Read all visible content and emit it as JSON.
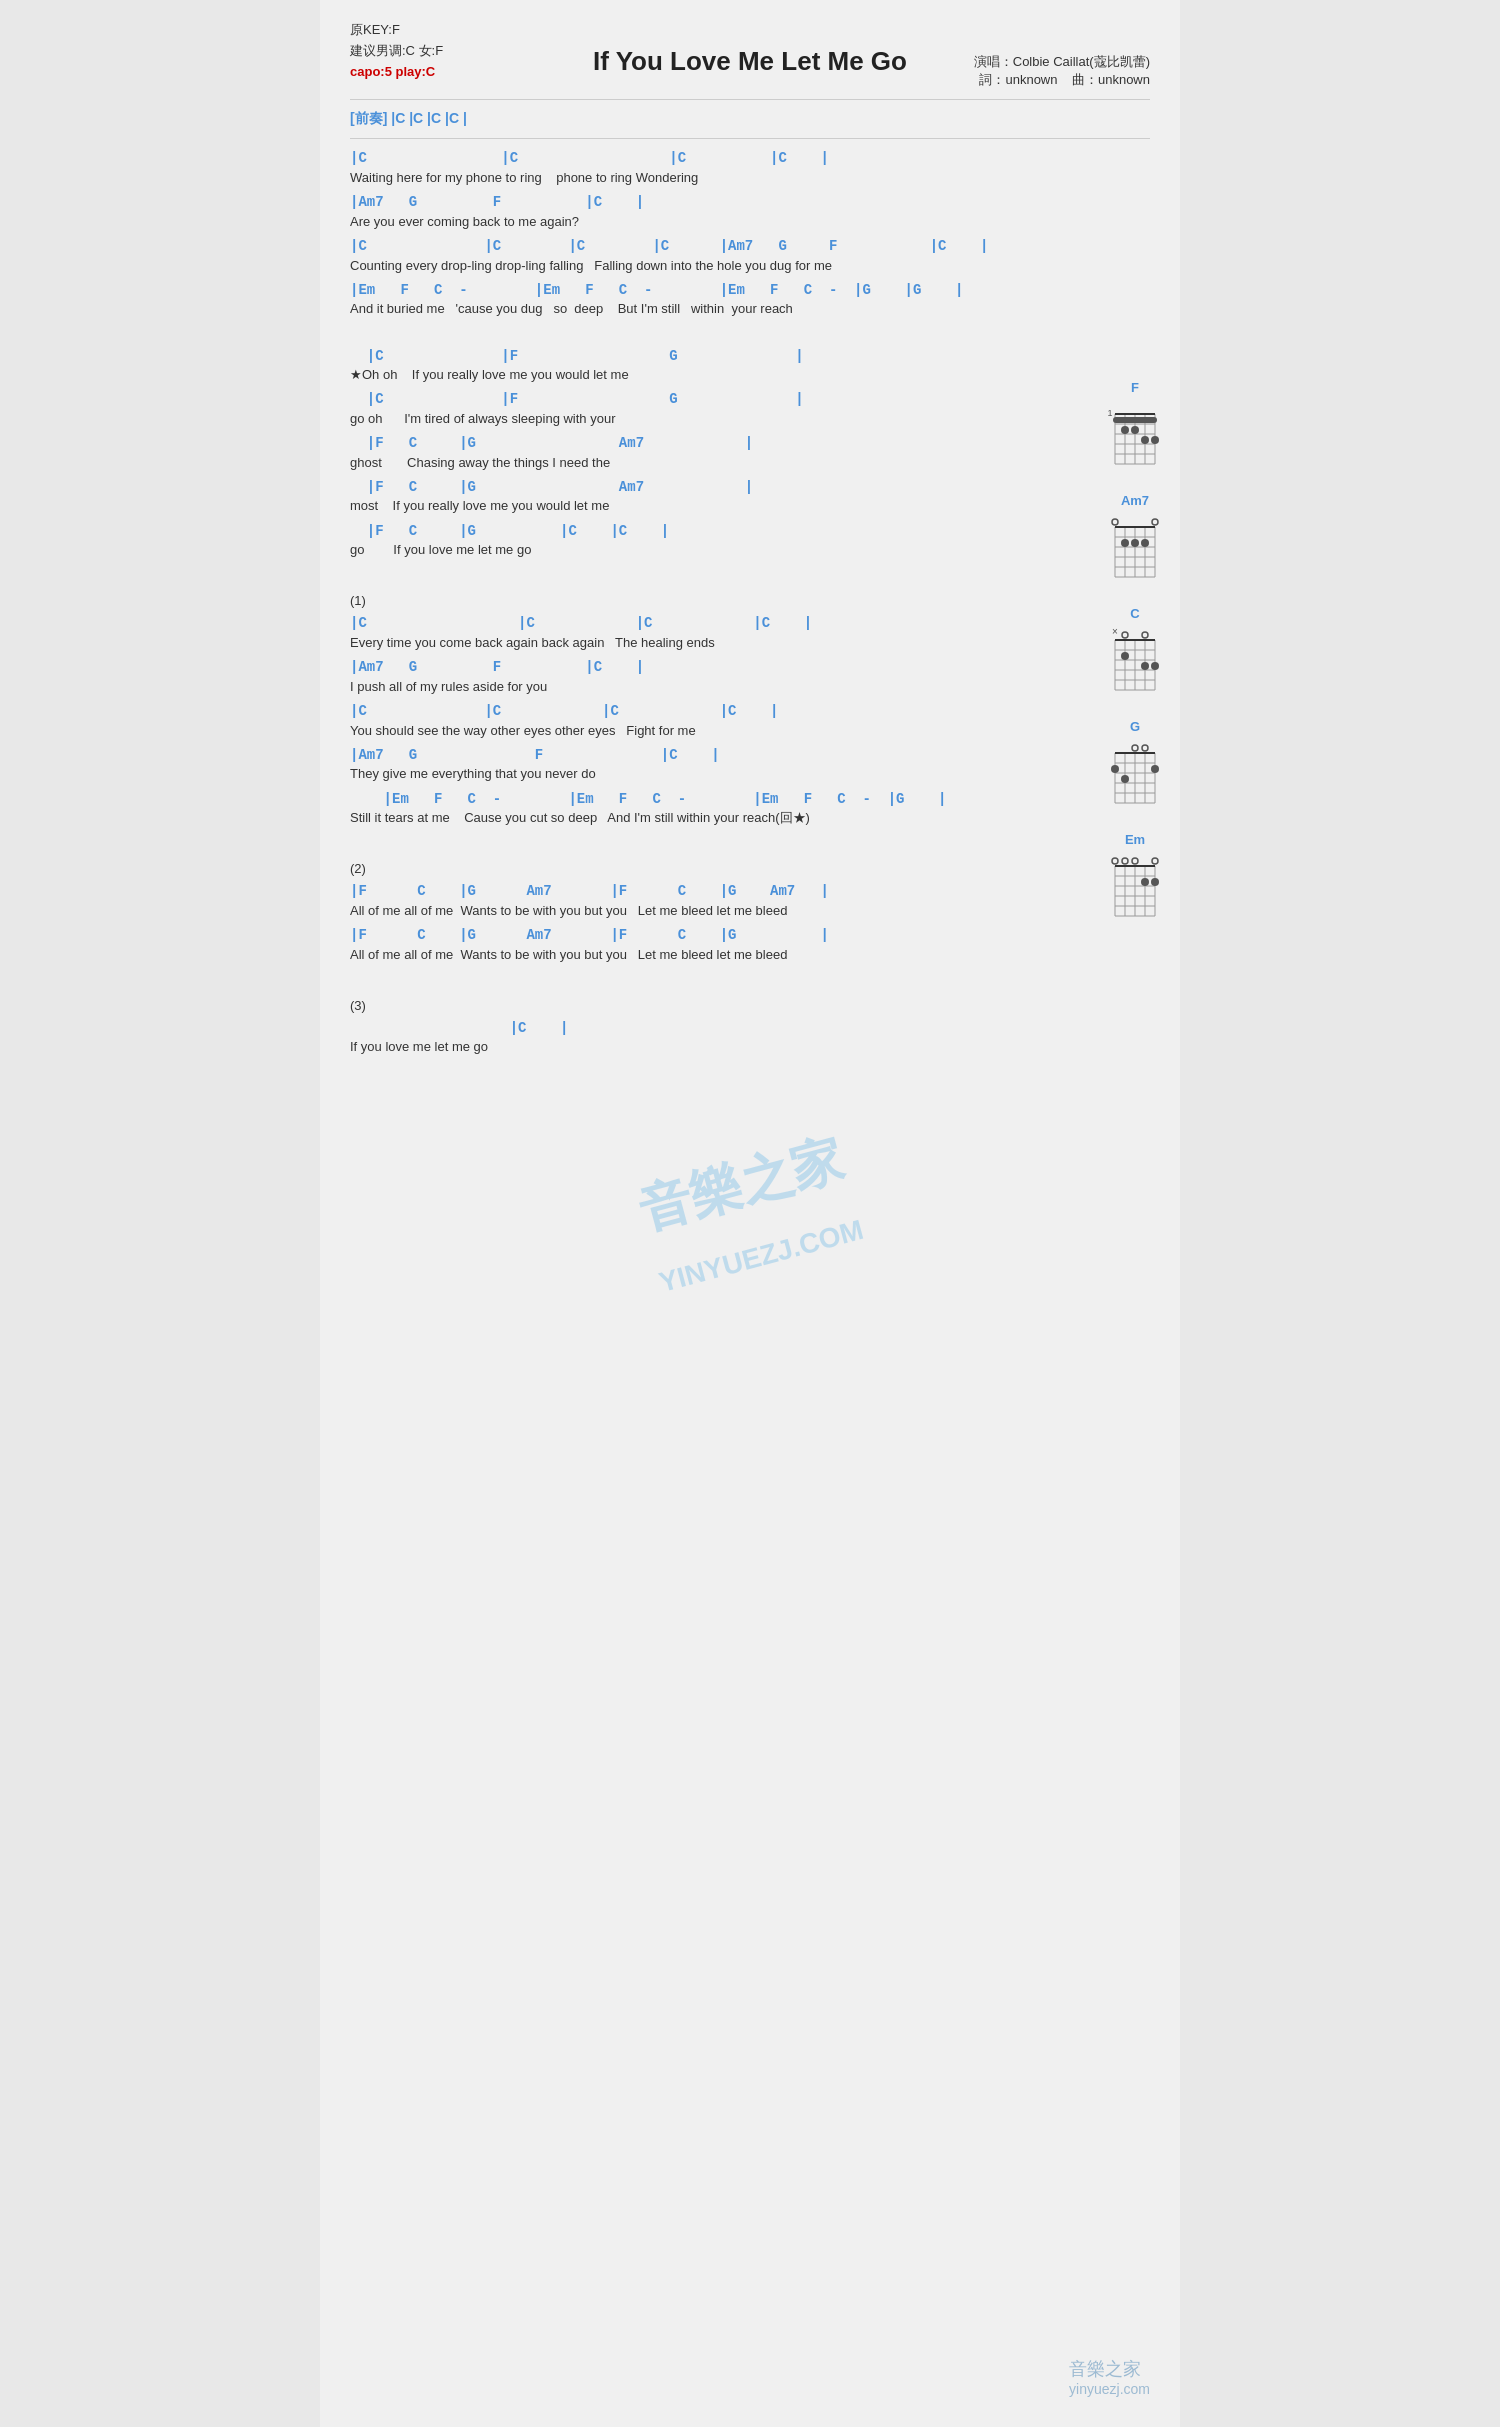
{
  "header": {
    "key": "原KEY:F",
    "suggestion": "建议男调:C 女:F",
    "capo": "capo:5 play:C",
    "title": "If You Love Me Let Me Go",
    "singer": "演唱：Colbie Caillat(蔻比凯蕾)",
    "words": "詞：unknown",
    "music": "曲：unknown"
  },
  "intro": {
    "label": "[前奏]",
    "chords": "|C  |C  |C  |C  |"
  },
  "sections": [
    {
      "id": "verse1",
      "lines": [
        {
          "type": "chord",
          "text": "|C                |C                  |C          |C    |"
        },
        {
          "type": "lyric",
          "text": "Waiting here for my phone to ring    phone to ring Wondering"
        },
        {
          "type": "chord",
          "text": "|Am7   G         F          |C    |"
        },
        {
          "type": "lyric",
          "text": "Are you ever coming back to me again?"
        },
        {
          "type": "chord",
          "text": "|C              |C        |C        |C      |Am7   G     F           |C    |"
        },
        {
          "type": "lyric",
          "text": "Counting every drop-ling drop-ling falling   Falling down into the hole you dug for me"
        },
        {
          "type": "chord",
          "text": "|Em   F   C  -        |Em   F   C  -        |Em   F   C  -  |G    |G    |"
        },
        {
          "type": "lyric",
          "text": "And it buried me   'cause you dug   so  deep    But I'm still   within  your reach"
        }
      ]
    },
    {
      "id": "chorus",
      "lines": [
        {
          "type": "chord",
          "text": "  |C              |F                  G              |"
        },
        {
          "type": "lyric",
          "text": "★Oh oh    If you really love me you would let me"
        },
        {
          "type": "chord",
          "text": "  |C              |F                  G              |"
        },
        {
          "type": "lyric",
          "text": "go oh      I'm tired of always sleeping with your"
        },
        {
          "type": "chord",
          "text": "  |F   C     |G                 Am7            |"
        },
        {
          "type": "lyric",
          "text": "ghost       Chasing away the things I need the"
        },
        {
          "type": "chord",
          "text": "  |F   C     |G                 Am7            |"
        },
        {
          "type": "lyric",
          "text": "most    If you really love me you would let me"
        },
        {
          "type": "chord",
          "text": "  |F   C     |G          |C    |C    |"
        },
        {
          "type": "lyric",
          "text": "go        If you love me let me go"
        }
      ]
    },
    {
      "id": "section1",
      "marker": "(1)",
      "lines": [
        {
          "type": "chord",
          "text": "|C                  |C            |C            |C    |"
        },
        {
          "type": "lyric",
          "text": "Every time you come back again back again   The healing ends"
        },
        {
          "type": "chord",
          "text": "|Am7   G         F          |C    |"
        },
        {
          "type": "lyric",
          "text": "I push all of my rules aside for you"
        },
        {
          "type": "chord",
          "text": "|C              |C            |C            |C    |"
        },
        {
          "type": "lyric",
          "text": "You should see the way other eyes other eyes   Fight for me"
        },
        {
          "type": "chord",
          "text": "|Am7   G              F              |C    |"
        },
        {
          "type": "lyric",
          "text": "They give me everything that you never do"
        },
        {
          "type": "chord",
          "text": "    |Em   F   C  -        |Em   F   C  -        |Em   F   C  -  |G    |"
        },
        {
          "type": "lyric",
          "text": "Still it tears at me    Cause you cut so deep   And I'm still within your reach(回★)"
        }
      ]
    },
    {
      "id": "section2",
      "marker": "(2)",
      "lines": [
        {
          "type": "chord",
          "text": "|F      C    |G      Am7       |F      C    |G    Am7   |"
        },
        {
          "type": "lyric",
          "text": "All of me all of me  Wants to be with you but you   Let me bleed let me bleed"
        },
        {
          "type": "chord",
          "text": "|F      C    |G      Am7       |F      C    |G          |"
        },
        {
          "type": "lyric",
          "text": "All of me all of me  Wants to be with you but you   Let me bleed let me bleed"
        }
      ]
    },
    {
      "id": "section3",
      "marker": "(3)",
      "lines": [
        {
          "type": "chord",
          "text": "                   |C    |"
        },
        {
          "type": "lyric",
          "text": "If you love me let me go"
        }
      ]
    }
  ],
  "diagrams": [
    {
      "label": "F",
      "fret_offset": 1,
      "dots": [
        [
          1,
          1
        ],
        [
          1,
          2
        ],
        [
          2,
          3
        ],
        [
          2,
          4
        ],
        [
          3,
          5
        ],
        [
          3,
          6
        ]
      ],
      "open": [],
      "muted": []
    },
    {
      "label": "Am7",
      "fret_offset": 0,
      "dots": [
        [
          2,
          2
        ],
        [
          2,
          3
        ],
        [
          2,
          4
        ]
      ],
      "open": [
        1,
        5,
        6
      ],
      "muted": []
    },
    {
      "label": "C",
      "fret_offset": 0,
      "dots": [
        [
          2,
          2
        ],
        [
          3,
          4
        ],
        [
          3,
          5
        ]
      ],
      "open": [
        1,
        3
      ],
      "muted": [
        6
      ]
    },
    {
      "label": "G",
      "fret_offset": 0,
      "dots": [
        [
          2,
          1
        ],
        [
          2,
          6
        ],
        [
          3,
          2
        ]
      ],
      "open": [
        3,
        4,
        5
      ],
      "muted": []
    },
    {
      "label": "Em",
      "fret_offset": 0,
      "dots": [
        [
          2,
          4
        ],
        [
          2,
          5
        ]
      ],
      "open": [
        1,
        2,
        3,
        6
      ],
      "muted": []
    }
  ],
  "watermark": "音樂之家",
  "watermark_url": "yinyuezj.com"
}
